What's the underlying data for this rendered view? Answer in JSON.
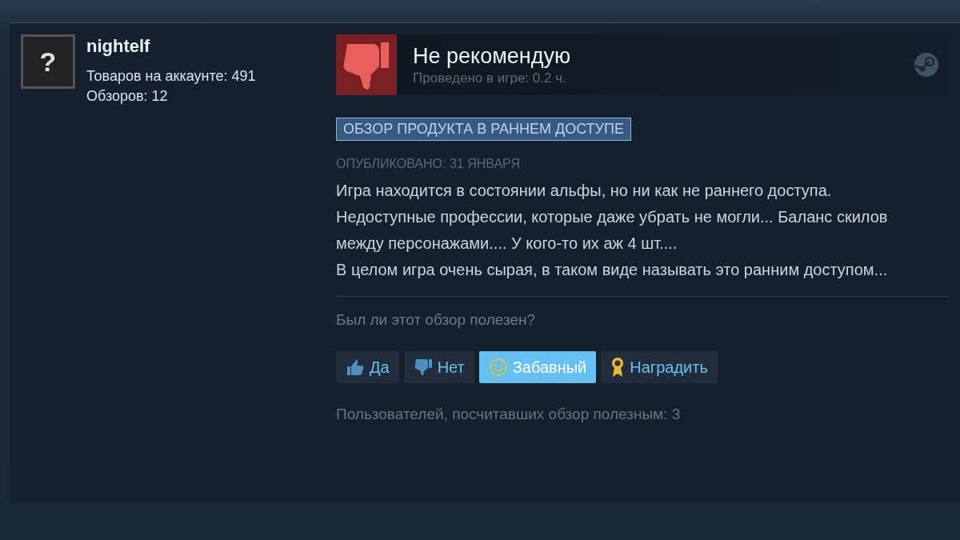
{
  "author": {
    "name": "nightelf",
    "products": "Товаров на аккаунте: 491",
    "reviews": "Обзоров: 12",
    "avatar_glyph": "?"
  },
  "review": {
    "verdict": "Не рекомендую",
    "recommended": false,
    "playtime": "Проведено в игре: 0.2 ч.",
    "badge": "ОБЗОР ПРОДУКТА В РАННЕМ ДОСТУПЕ",
    "posted": "ОПУБЛИКОВАНО: 31 ЯНВАРЯ",
    "paragraphs": [
      "Игра находится в состоянии альфы, но ни как не раннего доступа. Недоступные профессии, которые даже убрать не могли... Баланс скилов между персонажами.... У кого-то их аж 4 шт....",
      "В целом игра очень сырая, в таком виде называть это ранним доступом..."
    ]
  },
  "helpful": {
    "question": "Был ли этот обзор полезен?",
    "buttons": [
      {
        "kind": "up",
        "label": "Да",
        "selected": false
      },
      {
        "kind": "down",
        "label": "Нет",
        "selected": false
      },
      {
        "kind": "funny",
        "label": "Забавный",
        "selected": true
      },
      {
        "kind": "award",
        "label": "Наградить",
        "selected": false
      }
    ],
    "summary": "Пользователей, посчитавших обзор полезным: 3"
  }
}
